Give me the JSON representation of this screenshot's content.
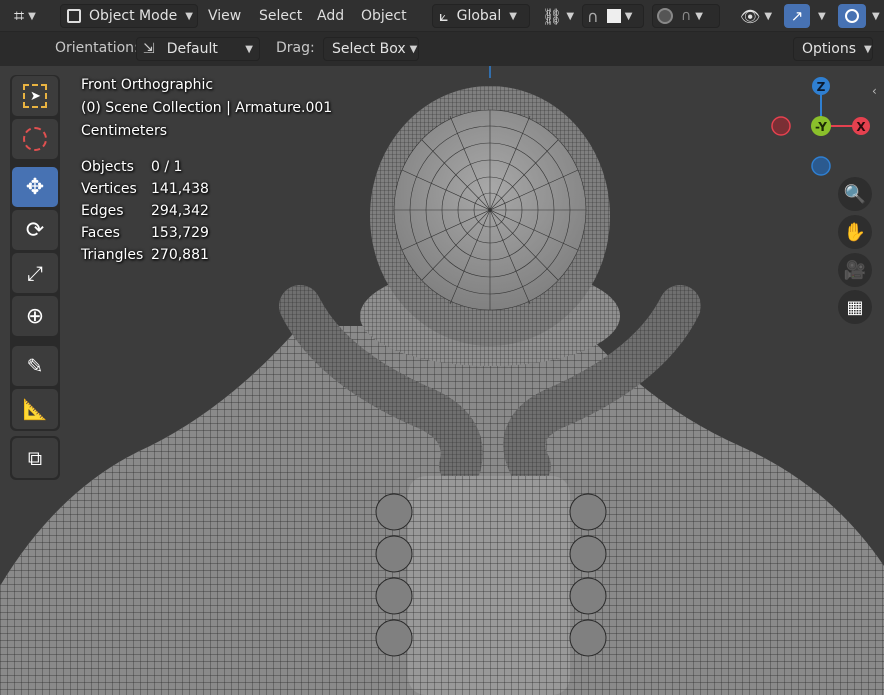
{
  "header": {
    "mode_label": "Object Mode",
    "menus": [
      "View",
      "Select",
      "Add",
      "Object"
    ],
    "transform_orientation": "Global"
  },
  "tool_header": {
    "orientation_label": "Orientation:",
    "orientation_value": "Default",
    "drag_label": "Drag:",
    "drag_value": "Select Box",
    "options_label": "Options"
  },
  "overlay": {
    "view_name": "Front Orthographic",
    "collection": "(0) Scene Collection | Armature.001",
    "units": "Centimeters",
    "stats": [
      {
        "label": "Objects",
        "value": "0 / 1"
      },
      {
        "label": "Vertices",
        "value": "141,438"
      },
      {
        "label": "Edges",
        "value": "294,342"
      },
      {
        "label": "Faces",
        "value": "153,729"
      },
      {
        "label": "Triangles",
        "value": "270,881"
      }
    ]
  },
  "gizmo": {
    "z_label": "Z",
    "y_label": "-Y",
    "x_label": "X"
  },
  "toolbar": {
    "tools": [
      "select-box",
      "cursor",
      "move",
      "rotate",
      "scale",
      "transform",
      "annotate",
      "measure",
      "add-cube"
    ],
    "active_tool": "move"
  },
  "colors": {
    "accent": "#4772b3",
    "axis_x": "#e5414f",
    "axis_y": "#8ac02b",
    "axis_z": "#2f7fd1"
  }
}
